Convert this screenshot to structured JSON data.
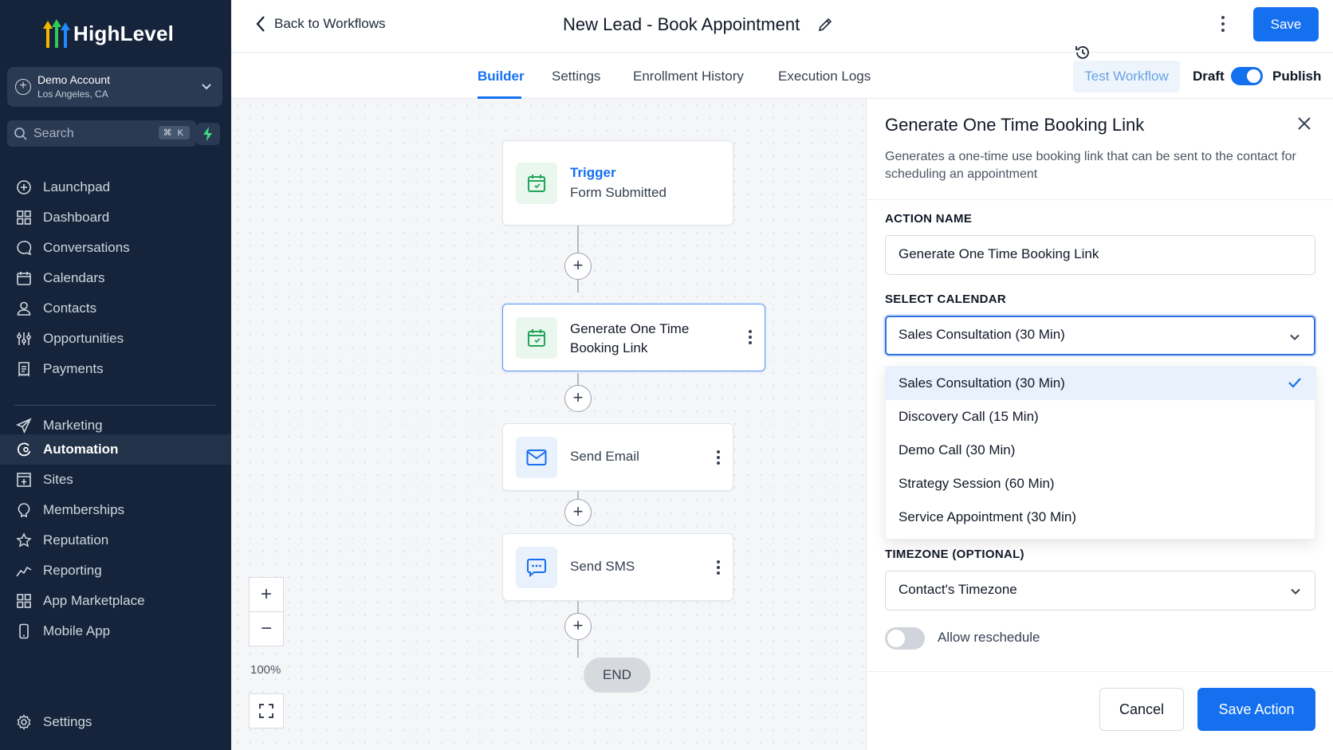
{
  "brand": {
    "name": "HighLevel",
    "accent": "#1570ef",
    "sidebar_bg": "#15243a"
  },
  "account": {
    "name": "Demo Account",
    "location": "Los Angeles, CA"
  },
  "search": {
    "placeholder": "Search",
    "shortcut": "⌘ K"
  },
  "nav": {
    "primary": [
      {
        "label": "Launchpad",
        "icon": "launchpad-icon"
      },
      {
        "label": "Dashboard",
        "icon": "dashboard-icon"
      },
      {
        "label": "Conversations",
        "icon": "chat-icon"
      },
      {
        "label": "Calendars",
        "icon": "calendar-icon"
      },
      {
        "label": "Contacts",
        "icon": "contacts-icon"
      },
      {
        "label": "Opportunities",
        "icon": "filter-icon"
      },
      {
        "label": "Payments",
        "icon": "receipt-icon"
      }
    ],
    "secondary": [
      {
        "label": "Marketing",
        "icon": "send-icon"
      },
      {
        "label": "Automation",
        "icon": "automation-icon",
        "active": true
      },
      {
        "label": "Sites",
        "icon": "sites-icon"
      },
      {
        "label": "Memberships",
        "icon": "membership-icon"
      },
      {
        "label": "Reputation",
        "icon": "star-icon"
      },
      {
        "label": "Reporting",
        "icon": "chart-icon"
      },
      {
        "label": "App Marketplace",
        "icon": "grid-icon"
      },
      {
        "label": "Mobile App",
        "icon": "mobile-icon"
      }
    ],
    "settings": {
      "label": "Settings",
      "icon": "gear-icon"
    }
  },
  "header": {
    "back_label": "Back to Workflows",
    "workflow_title": "New Lead - Book Appointment",
    "save_label": "Save"
  },
  "tabs": [
    {
      "label": "Builder",
      "active": true
    },
    {
      "label": "Settings"
    },
    {
      "label": "Enrollment History"
    },
    {
      "label": "Execution Logs"
    }
  ],
  "toolbar": {
    "test_label": "Test Workflow",
    "draft_label": "Draft",
    "publish_label": "Publish"
  },
  "canvas": {
    "trigger": {
      "title": "Trigger",
      "subtitle": "Form Submitted"
    },
    "actions": [
      {
        "label": "Generate One Time Booking Link",
        "icon": "calendar-icon",
        "selected": true
      },
      {
        "label": "Send Email",
        "icon": "mail-icon"
      },
      {
        "label": "Send SMS",
        "icon": "sms-icon"
      }
    ],
    "end_label": "END",
    "zoom_level": "100%"
  },
  "panel": {
    "title": "Generate One Time Booking Link",
    "description": "Generates a one-time use booking link that can be sent to the contact for scheduling an appointment",
    "action_name_label": "ACTION NAME",
    "action_name_value": "Generate One Time Booking Link",
    "calendar_label": "SELECT CALENDAR",
    "calendar_value": "Sales Consultation (30 Min)",
    "calendar_options": [
      "Sales Consultation (30 Min)",
      "Discovery Call (15 Min)",
      "Demo Call (30 Min)",
      "Strategy Session (60 Min)",
      "Service Appointment (30 Min)"
    ],
    "timezone_label": "TIMEZONE (OPTIONAL)",
    "timezone_value": "Contact's Timezone",
    "reschedule_label": "Allow reschedule",
    "cancel_label": "Cancel",
    "save_action_label": "Save Action"
  }
}
